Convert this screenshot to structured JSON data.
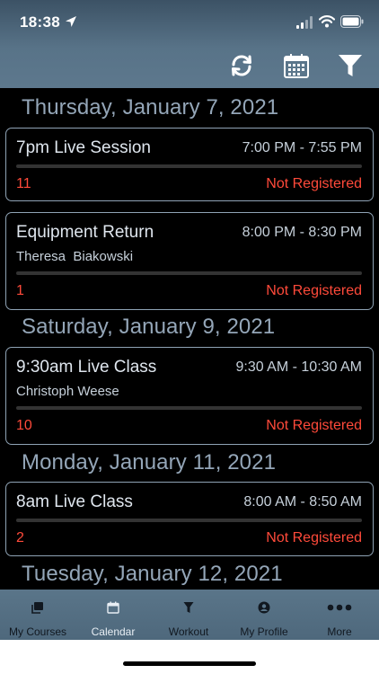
{
  "status_bar": {
    "time": "18:38"
  },
  "schedule": [
    {
      "heading": "Thursday, January 7, 2021",
      "events": [
        {
          "title": "7pm Live Session",
          "time": "7:00 PM - 7:55 PM",
          "instructor": "",
          "count": "11",
          "status": "Not Registered"
        },
        {
          "title": "Equipment Return",
          "time": "8:00 PM - 8:30 PM",
          "instructor": "Theresa  Biakowski",
          "count": "1",
          "status": "Not Registered"
        }
      ]
    },
    {
      "heading": "Saturday, January 9, 2021",
      "events": [
        {
          "title": "9:30am Live Class",
          "time": "9:30 AM - 10:30 AM",
          "instructor": "Christoph Weese",
          "count": "10",
          "status": "Not Registered"
        }
      ]
    },
    {
      "heading": "Monday, January 11, 2021",
      "events": [
        {
          "title": "8am Live Class",
          "time": "8:00 AM - 8:50 AM",
          "instructor": "",
          "count": "2",
          "status": "Not Registered"
        }
      ]
    },
    {
      "heading": "Tuesday, January 12, 2021",
      "events": []
    }
  ],
  "tabs": [
    {
      "label": "My Courses",
      "icon": "courses-icon"
    },
    {
      "label": "Calendar",
      "icon": "calendar-icon"
    },
    {
      "label": "Workout",
      "icon": "workout-icon"
    },
    {
      "label": "My Profile",
      "icon": "profile-icon"
    },
    {
      "label": "More",
      "icon": "more-icon"
    }
  ],
  "active_tab": "Calendar",
  "colors": {
    "accent_red": "#ff4a3a",
    "header": "#587388",
    "heading_text": "#94a6b8",
    "card_border": "#8fa3b5"
  }
}
